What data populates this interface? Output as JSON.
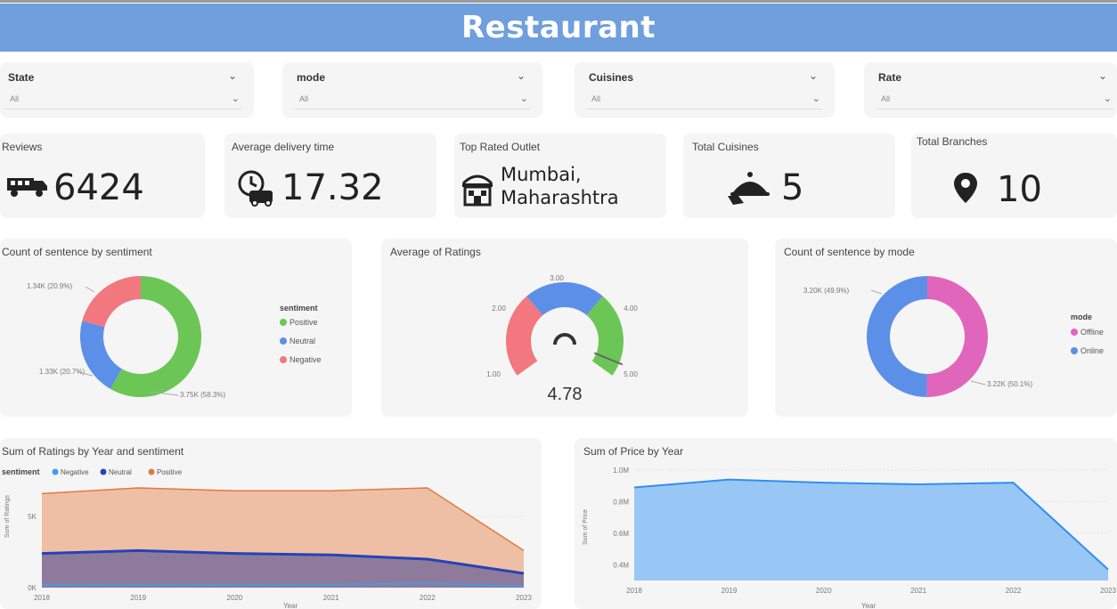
{
  "header": {
    "title": "Restaurant"
  },
  "slicers": [
    {
      "label": "State",
      "value": "All"
    },
    {
      "label": "mode",
      "value": "All"
    },
    {
      "label": "Cuisines",
      "value": "All"
    },
    {
      "label": "Rate",
      "value": "All"
    }
  ],
  "kpis": {
    "reviews": {
      "title": "Reviews",
      "value": "6424"
    },
    "delivery": {
      "title": "Average delivery time",
      "value": "17.32"
    },
    "outlet": {
      "title": "Top Rated Outlet",
      "line1": "Mumbai,",
      "line2": "Maharashtra"
    },
    "cuisines": {
      "title": "Total Cuisines",
      "value": "5"
    },
    "branches": {
      "title": "Total Branches",
      "value": "10"
    }
  },
  "colors": {
    "positive": "#6cc655",
    "neutral": "#5b8fe8",
    "negative": "#f2777e",
    "offline": "#e066bc",
    "online": "#5b8fe8",
    "area_positive": "#eebfa5",
    "area_positive_line": "#e07a3f",
    "area_neutral": "#8e7b9c",
    "area_neutral_line": "#2543b8",
    "area_negative_line": "#3aa0f2",
    "price_fill": "#99c7f5",
    "price_line": "#2f8ff0"
  },
  "chart_data": [
    {
      "type": "pie",
      "title": "Count of sentence by sentiment",
      "legend_title": "sentiment",
      "legend_position": "right",
      "categories": [
        "Positive",
        "Neutral",
        "Negative"
      ],
      "values": [
        3.75,
        1.33,
        1.34
      ],
      "labels": [
        "3.75K (58.3%)",
        "1.33K (20.7%)",
        "1.34K (20.9%)"
      ],
      "hole": true
    },
    {
      "type": "gauge",
      "title": "Average of Ratings",
      "value": 4.78,
      "value_label": "4.78",
      "min": 1,
      "max": 5,
      "ticks": [
        "1.00",
        "2.00",
        "3.00",
        "4.00",
        "5.00"
      ],
      "bands": [
        {
          "from": 1,
          "to": 2,
          "color": "#f2777e"
        },
        {
          "from": 2,
          "to": 3,
          "color": "#f2777e"
        },
        {
          "from": 3,
          "to": 4,
          "color": "#5b8fe8"
        },
        {
          "from": 4,
          "to": 5,
          "color": "#6cc655"
        }
      ]
    },
    {
      "type": "pie",
      "title": "Count of sentence by mode",
      "legend_title": "mode",
      "legend_position": "right",
      "categories": [
        "Offline",
        "Online"
      ],
      "values": [
        3.22,
        3.2
      ],
      "labels": [
        "3.22K (50.1%)",
        "3.20K (49.9%)"
      ],
      "hole": true
    },
    {
      "type": "area",
      "title": "Sum of Ratings by Year and sentiment",
      "legend_title": "sentiment",
      "legend_position": "top-left",
      "ylabel": "Sum of Ratings",
      "xlabel": "Year",
      "x": [
        "2018",
        "2019",
        "2020",
        "2021",
        "2022",
        "2023"
      ],
      "yticks": [
        "0K",
        "5K"
      ],
      "ylim": [
        0,
        8
      ],
      "series": [
        {
          "name": "Negative",
          "values": [
            0.2,
            0.2,
            0.2,
            0.2,
            0.3,
            0.1
          ]
        },
        {
          "name": "Neutral",
          "values": [
            2.4,
            2.6,
            2.4,
            2.3,
            2.0,
            1.0
          ]
        },
        {
          "name": "Positive",
          "values": [
            6.6,
            7.0,
            6.8,
            6.8,
            7.0,
            2.6
          ]
        }
      ],
      "stacked": false
    },
    {
      "type": "area",
      "title": "Sum of Price by Year",
      "ylabel": "Sum of Price",
      "xlabel": "Year",
      "x": [
        "2018",
        "2019",
        "2020",
        "2021",
        "2022",
        "2023"
      ],
      "yticks": [
        "0.4M",
        "0.6M",
        "0.8M",
        "1.0M"
      ],
      "ylim": [
        0.3,
        1.0
      ],
      "series": [
        {
          "name": "",
          "values": [
            0.89,
            0.94,
            0.92,
            0.91,
            0.92,
            0.37
          ]
        }
      ]
    }
  ]
}
